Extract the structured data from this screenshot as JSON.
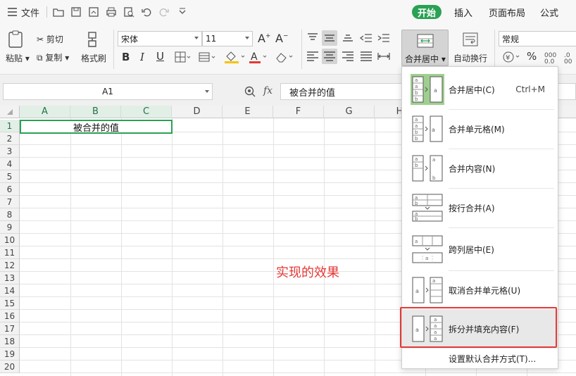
{
  "topbar": {
    "file_label": "文件",
    "tabs": [
      {
        "label": "开始",
        "active": true
      },
      {
        "label": "插入",
        "active": false
      },
      {
        "label": "页面布局",
        "active": false
      },
      {
        "label": "公式",
        "active": false
      }
    ]
  },
  "ribbon": {
    "paste_label": "粘贴",
    "cut_label": "剪切",
    "copy_label": "复制",
    "format_painter_label": "格式刷",
    "font_name": "宋体",
    "font_size": "11",
    "merge_center_label": "合并居中",
    "wrap_text_label": "自动换行",
    "number_format": "常规",
    "percent_symbol": "%"
  },
  "formula_bar": {
    "cell_ref": "A1",
    "fx_label": "fx",
    "content": "被合并的值"
  },
  "grid": {
    "columns": [
      "A",
      "B",
      "C",
      "D",
      "E",
      "F",
      "G",
      "H"
    ],
    "rows": [
      "1",
      "2",
      "3",
      "4",
      "5",
      "6",
      "7",
      "8",
      "9",
      "10",
      "11",
      "12",
      "13",
      "14",
      "15",
      "16",
      "17",
      "18",
      "19",
      "20"
    ],
    "merged_cell_value": "被合并的值",
    "annotation": "实现的效果"
  },
  "merge_menu": {
    "items": [
      {
        "label": "合并居中(C)",
        "shortcut": "Ctrl+M"
      },
      {
        "label": "合并单元格(M)",
        "shortcut": ""
      },
      {
        "label": "合并内容(N)",
        "shortcut": ""
      },
      {
        "label": "按行合并(A)",
        "shortcut": ""
      },
      {
        "label": "跨列居中(E)",
        "shortcut": ""
      },
      {
        "label": "取消合并单元格(U)",
        "shortcut": ""
      },
      {
        "label": "拆分并填充内容(F)",
        "shortcut": ""
      }
    ],
    "default_setting_label": "设置默认合并方式(T)..."
  },
  "colors": {
    "accent_green": "#2aa155",
    "highlight_red": "#e53935"
  }
}
